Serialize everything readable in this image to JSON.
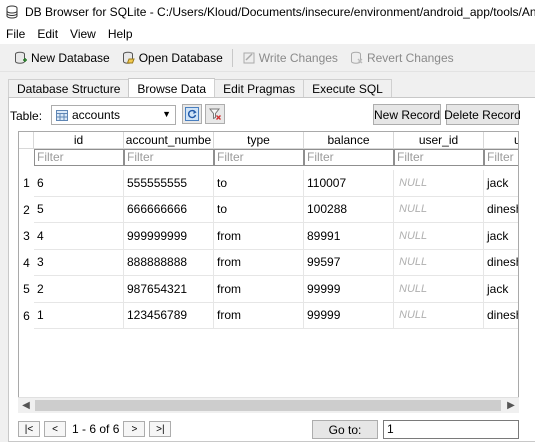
{
  "window": {
    "title": "DB Browser for SQLite - C:/Users/Kloud/Documents/insecure/environment/android_app/tools/Android-In"
  },
  "menu": [
    "File",
    "Edit",
    "View",
    "Help"
  ],
  "toolbar": {
    "new_database": "New Database",
    "open_database": "Open Database",
    "write_changes": "Write Changes",
    "revert_changes": "Revert Changes"
  },
  "tabs": [
    "Database Structure",
    "Browse Data",
    "Edit Pragmas",
    "Execute SQL"
  ],
  "active_tab": "Browse Data",
  "browse": {
    "table_label": "Table:",
    "table_value": "accounts",
    "new_record": "New Record",
    "delete_record": "Delete Record",
    "filter_placeholder": "Filter",
    "columns": [
      "id",
      "account_numbe",
      "type",
      "balance",
      "user_id",
      "u"
    ],
    "row_numbers": [
      "1",
      "2",
      "3",
      "4",
      "5",
      "6"
    ],
    "rows": [
      [
        "6",
        "555555555",
        "to",
        "110007",
        "NULL",
        "jack"
      ],
      [
        "5",
        "666666666",
        "to",
        "100288",
        "NULL",
        "dinesh"
      ],
      [
        "4",
        "999999999",
        "from",
        "89991",
        "NULL",
        "jack"
      ],
      [
        "3",
        "888888888",
        "from",
        "99597",
        "NULL",
        "dinesh"
      ],
      [
        "2",
        "987654321",
        "from",
        "99999",
        "NULL",
        "jack"
      ],
      [
        "1",
        "123456789",
        "from",
        "99999",
        "NULL",
        "dinesh"
      ]
    ]
  },
  "pager": {
    "first": "|<",
    "prev": "<",
    "status": "1 - 6 of 6",
    "next": ">",
    "last": ">|",
    "goto_label": "Go to:",
    "goto_value": "1"
  },
  "icons": {
    "app": "db-cylinder-icon",
    "refresh": "refresh-icon",
    "clear_filter": "clear-filter-icon",
    "table": "table-icon"
  }
}
